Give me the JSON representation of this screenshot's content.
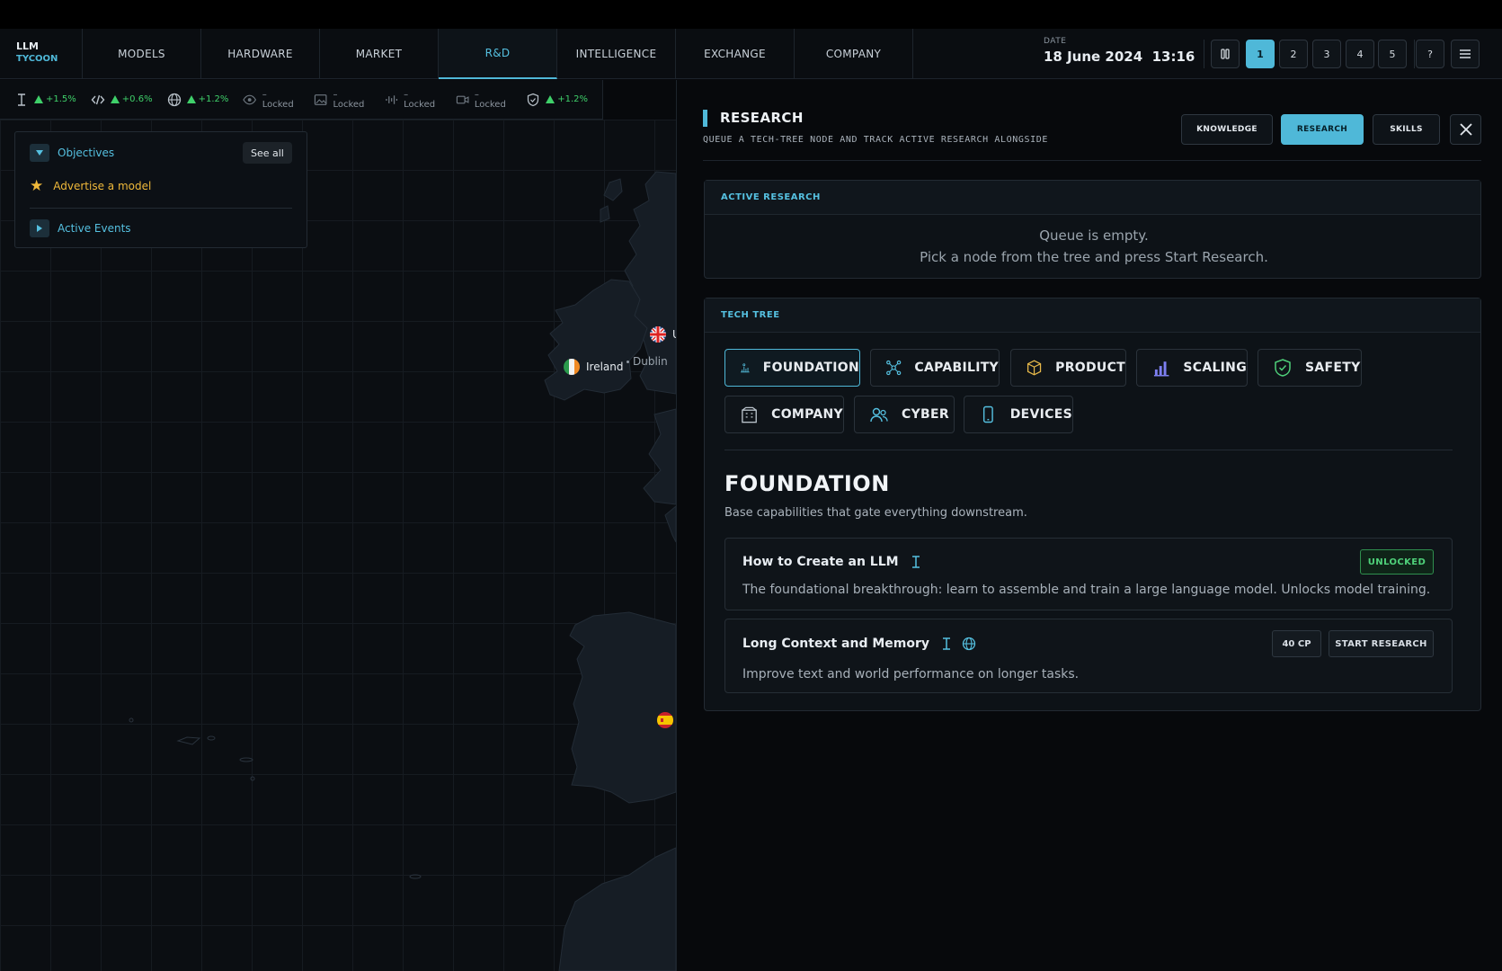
{
  "logo": {
    "line1": "LLM",
    "line2": "TYCOON"
  },
  "nav": {
    "tabs": [
      {
        "label": "MODELS"
      },
      {
        "label": "HARDWARE"
      },
      {
        "label": "MARKET"
      },
      {
        "label": "R&D",
        "active": true
      },
      {
        "label": "INTELLIGENCE"
      },
      {
        "label": "EXCHANGE"
      },
      {
        "label": "COMPANY"
      }
    ],
    "date_label": "DATE",
    "date_value": "18 June 2024  13:16",
    "speed_buttons": [
      "1",
      "2",
      "3",
      "4",
      "5"
    ],
    "selected_speed": "1",
    "help_label": "?"
  },
  "stats": [
    {
      "icon": "text-cursor-icon",
      "value": "+1.5%"
    },
    {
      "icon": "code-icon",
      "value": "+0.6%"
    },
    {
      "icon": "globe-icon",
      "value": "+1.2%"
    },
    {
      "icon": "eye-icon",
      "value": "– Locked"
    },
    {
      "icon": "image-icon",
      "value": "– Locked"
    },
    {
      "icon": "audio-icon",
      "value": "– Locked"
    },
    {
      "icon": "video-icon",
      "value": "– Locked"
    },
    {
      "icon": "shield-icon",
      "value": "+1.2%"
    }
  ],
  "objectives": {
    "title": "Objectives",
    "see_all": "See all",
    "item": "Advertise a model",
    "events": "Active Events"
  },
  "map": {
    "labels": {
      "ireland": "Ireland",
      "dublin": "Dublin",
      "uk_partial": "U"
    }
  },
  "research": {
    "title": "RESEARCH",
    "subtitle": "QUEUE A TECH-TREE NODE AND TRACK ACTIVE RESEARCH ALONGSIDE",
    "tabs": {
      "knowledge": "KNOWLEDGE",
      "research": "RESEARCH",
      "skills": "SKILLS"
    },
    "active": {
      "header": "ACTIVE RESEARCH",
      "empty_line1": "Queue is empty.",
      "empty_line2": "Pick a node from the tree and press Start Research."
    },
    "tree": {
      "header": "TECH TREE",
      "categories": [
        "FOUNDATION",
        "CAPABILITY",
        "PRODUCT",
        "SCALING",
        "SAFETY",
        "COMPANY",
        "CYBER",
        "DEVICES"
      ],
      "selected": "FOUNDATION",
      "section_title": "FOUNDATION",
      "section_desc": "Base capabilities that gate everything downstream.",
      "nodes": [
        {
          "name": "How to Create an LLM",
          "desc": "The foundational breakthrough: learn to assemble and train a large language model. Unlocks model training.",
          "status": "UNLOCKED"
        },
        {
          "name": "Long Context and Memory",
          "desc": "Improve text and world performance on longer tasks.",
          "cost": "40 CP",
          "action": "START RESEARCH"
        }
      ]
    }
  },
  "colors": {
    "accent": "#4fb8d8",
    "success": "#3fd06a",
    "warning": "#f0b93a"
  }
}
